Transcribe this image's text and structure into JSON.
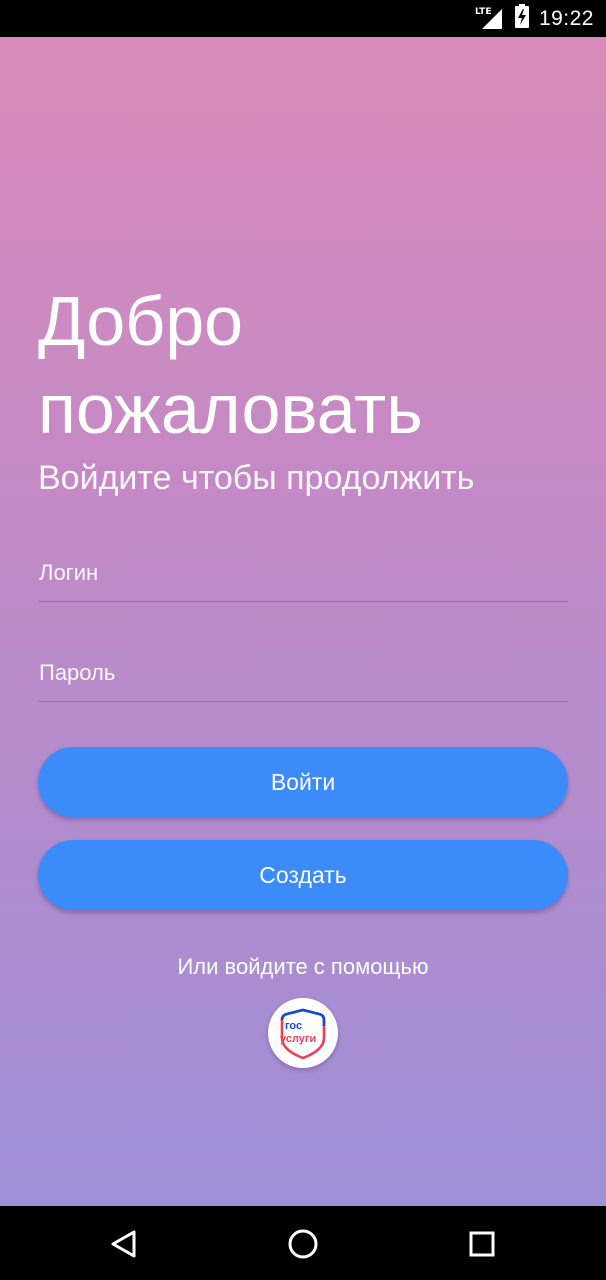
{
  "status_bar": {
    "network_label": "LTE",
    "time": "19:22",
    "icons": [
      "lte-signal-icon",
      "battery-charging-icon"
    ]
  },
  "welcome": {
    "title": "Добро пожаловать",
    "subtitle": "Войдите чтобы продолжить"
  },
  "form": {
    "login_placeholder": "Логин",
    "password_placeholder": "Пароль",
    "login_value": "",
    "password_value": ""
  },
  "buttons": {
    "login_label": "Войти",
    "create_label": "Создать"
  },
  "alt_login": {
    "text": "Или войдите с помощью",
    "gosuslugi_logo_text": [
      "гос",
      "услуги"
    ],
    "icon": "gosuslugi-logo-icon"
  },
  "nav_bar": {
    "icons": [
      "back-icon",
      "home-icon",
      "recents-icon"
    ]
  },
  "colors": {
    "gradient_top": "#d88bba",
    "gradient_bottom": "#9f8fd6",
    "button": "#3b8bfb",
    "logo_blue": "#0d4cd3",
    "logo_red": "#ee3f58"
  }
}
